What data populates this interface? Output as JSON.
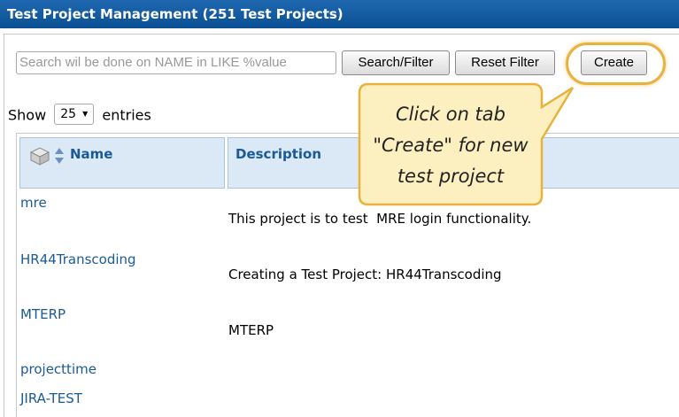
{
  "window": {
    "title": "Test Project Management (251 Test Projects)"
  },
  "toolbar": {
    "search_placeholder": "Search wil be done on NAME in LIKE %value",
    "search_filter_label": "Search/Filter",
    "reset_filter_label": "Reset Filter",
    "create_label": "Create"
  },
  "paging": {
    "show_label": "Show",
    "entries_value": "25",
    "entries_label": "entries"
  },
  "table": {
    "columns": [
      "Name",
      "Description"
    ],
    "rows": [
      {
        "name": "mre",
        "description": "This project is to test  MRE login functionality."
      },
      {
        "name": "HR44Transcoding",
        "description": "Creating a Test Project: HR44Transcoding"
      },
      {
        "name": "MTERP",
        "description": "MTERP"
      },
      {
        "name": "projecttime",
        "description": ""
      },
      {
        "name": "JIRA-TEST",
        "description": ""
      }
    ]
  },
  "callout": {
    "text": "Click on tab \"Create\" for new test project"
  },
  "colors": {
    "titlebar": "#0b5394",
    "header_bg": "#dbe9f7",
    "link": "#1a5a96",
    "callout_fill": "#fdf0c0",
    "callout_border": "#e8b23c"
  }
}
